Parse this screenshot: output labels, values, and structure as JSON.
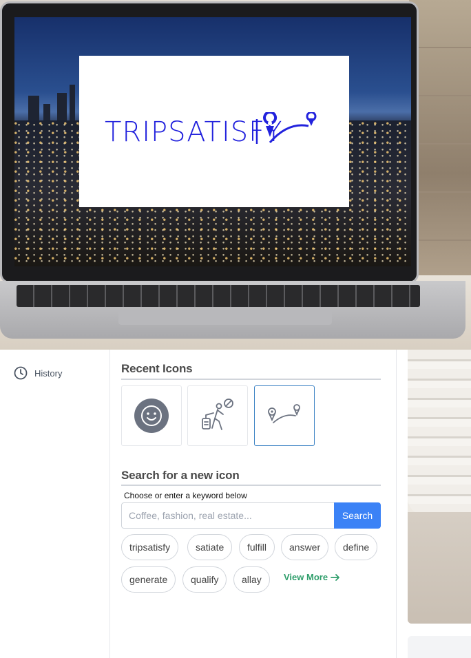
{
  "hero": {
    "logo_text": "TRIPSATISFY",
    "logo_color": "#2222dd"
  },
  "sidebar": {
    "history_label": "History",
    "history_icon": "clock-icon"
  },
  "recent": {
    "title": "Recent Icons",
    "icons": [
      {
        "name": "smiley-face-icon"
      },
      {
        "name": "traveler-luggage-icon"
      },
      {
        "name": "route-pins-icon",
        "selected": true
      }
    ]
  },
  "search": {
    "title": "Search for a new icon",
    "label": "Choose or enter a keyword below",
    "placeholder": "Coffee, fashion, real estate...",
    "button": "Search",
    "accent": "#3b82f6"
  },
  "keywords": [
    "tripsatisfy",
    "satiate",
    "fulfill",
    "answer",
    "define",
    "generate",
    "qualify",
    "allay"
  ],
  "view_more": {
    "label": "View More",
    "color": "#2f9e6b"
  }
}
